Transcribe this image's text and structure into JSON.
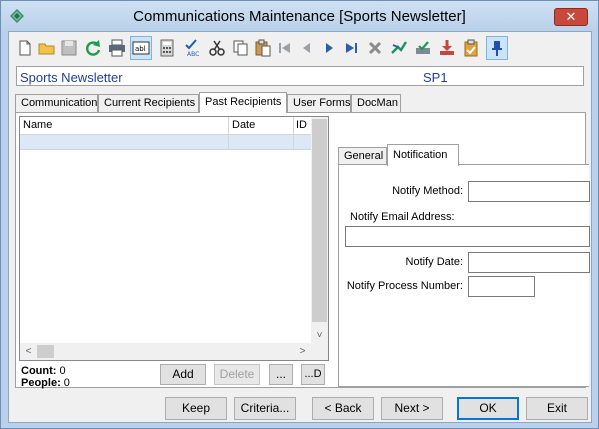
{
  "window": {
    "title": "Communications Maintenance  [Sports Newsletter]",
    "close_glyph": "✕"
  },
  "toolbar": {
    "icons": [
      "new-icon",
      "open-icon",
      "save-icon",
      "refresh-icon",
      "print-icon",
      "text-field-icon",
      "calculator-icon",
      "spellcheck-icon",
      "cut-icon",
      "copy-icon",
      "paste-icon",
      "first-record-icon",
      "previous-record-icon",
      "next-record-icon",
      "last-record-icon",
      "delete-icon",
      "go-icon",
      "approve-icon",
      "download-icon",
      "clipboard-check-icon",
      "pin-icon"
    ]
  },
  "header": {
    "name": "Sports Newsletter",
    "code": "SP1"
  },
  "tabs": [
    {
      "label": "Communication"
    },
    {
      "label": "Current Recipients"
    },
    {
      "label": "Past Recipients"
    },
    {
      "label": "User Forms"
    },
    {
      "label": "DocMan"
    }
  ],
  "list": {
    "columns": [
      "Name",
      "Date",
      "ID"
    ],
    "scroll_down_glyph": "˅",
    "scroll_left_glyph": "<",
    "scroll_right_glyph": ">"
  },
  "counts": {
    "count_label": "Count:",
    "count_value": "0",
    "people_label": "People:",
    "people_value": "0"
  },
  "list_buttons": {
    "add": "Add",
    "delete": "Delete",
    "more": "...",
    "more_d": "...D"
  },
  "subtabs": [
    {
      "label": "General"
    },
    {
      "label": "Notification"
    }
  ],
  "notification": {
    "method_label": "Notify Method:",
    "method_value": "",
    "email_label": "Notify Email Address:",
    "email_value": "",
    "date_label": "Notify Date:",
    "date_value": "",
    "process_label": "Notify Process Number:",
    "process_value": ""
  },
  "footer": {
    "keep": "Keep",
    "criteria": "Criteria...",
    "back": "< Back",
    "next": "Next >",
    "ok": "OK",
    "exit": "Exit"
  }
}
